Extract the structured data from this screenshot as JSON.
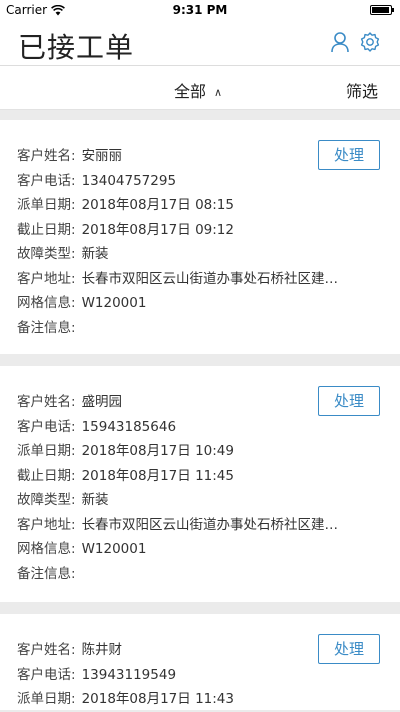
{
  "status_bar": {
    "carrier": "Carrier",
    "time": "9:31 PM",
    "battery_level": 0.95
  },
  "header": {
    "title": "已接工单"
  },
  "filter_bar": {
    "all_label": "全部",
    "caret": "∧",
    "filter_label": "筛选"
  },
  "labels": {
    "name": "客户姓名:",
    "phone": "客户电话:",
    "dispatch": "派单日期:",
    "deadline": "截止日期:",
    "fault": "故障类型:",
    "address": "客户地址:",
    "grid": "网格信息:",
    "remark": "备注信息:"
  },
  "orders": [
    {
      "name": "安丽丽",
      "phone": "13404757295",
      "dispatch": "2018年08月17日 08:15",
      "deadline": "2018年08月17日 09:12",
      "fault": "新装",
      "address": "长春市双阳区云山街道办事处石桥社区建…",
      "grid": "W120001",
      "remark": "",
      "action": "处理"
    },
    {
      "name": "盛明园",
      "phone": "15943185646",
      "dispatch": "2018年08月17日 10:49",
      "deadline": "2018年08月17日 11:45",
      "fault": "新装",
      "address": "长春市双阳区云山街道办事处石桥社区建…",
      "grid": "W120001",
      "remark": "",
      "action": "处理"
    },
    {
      "name": "陈井财",
      "phone": "13943119549",
      "dispatch": "2018年08月17日 11:43",
      "action": "处理"
    }
  ]
}
